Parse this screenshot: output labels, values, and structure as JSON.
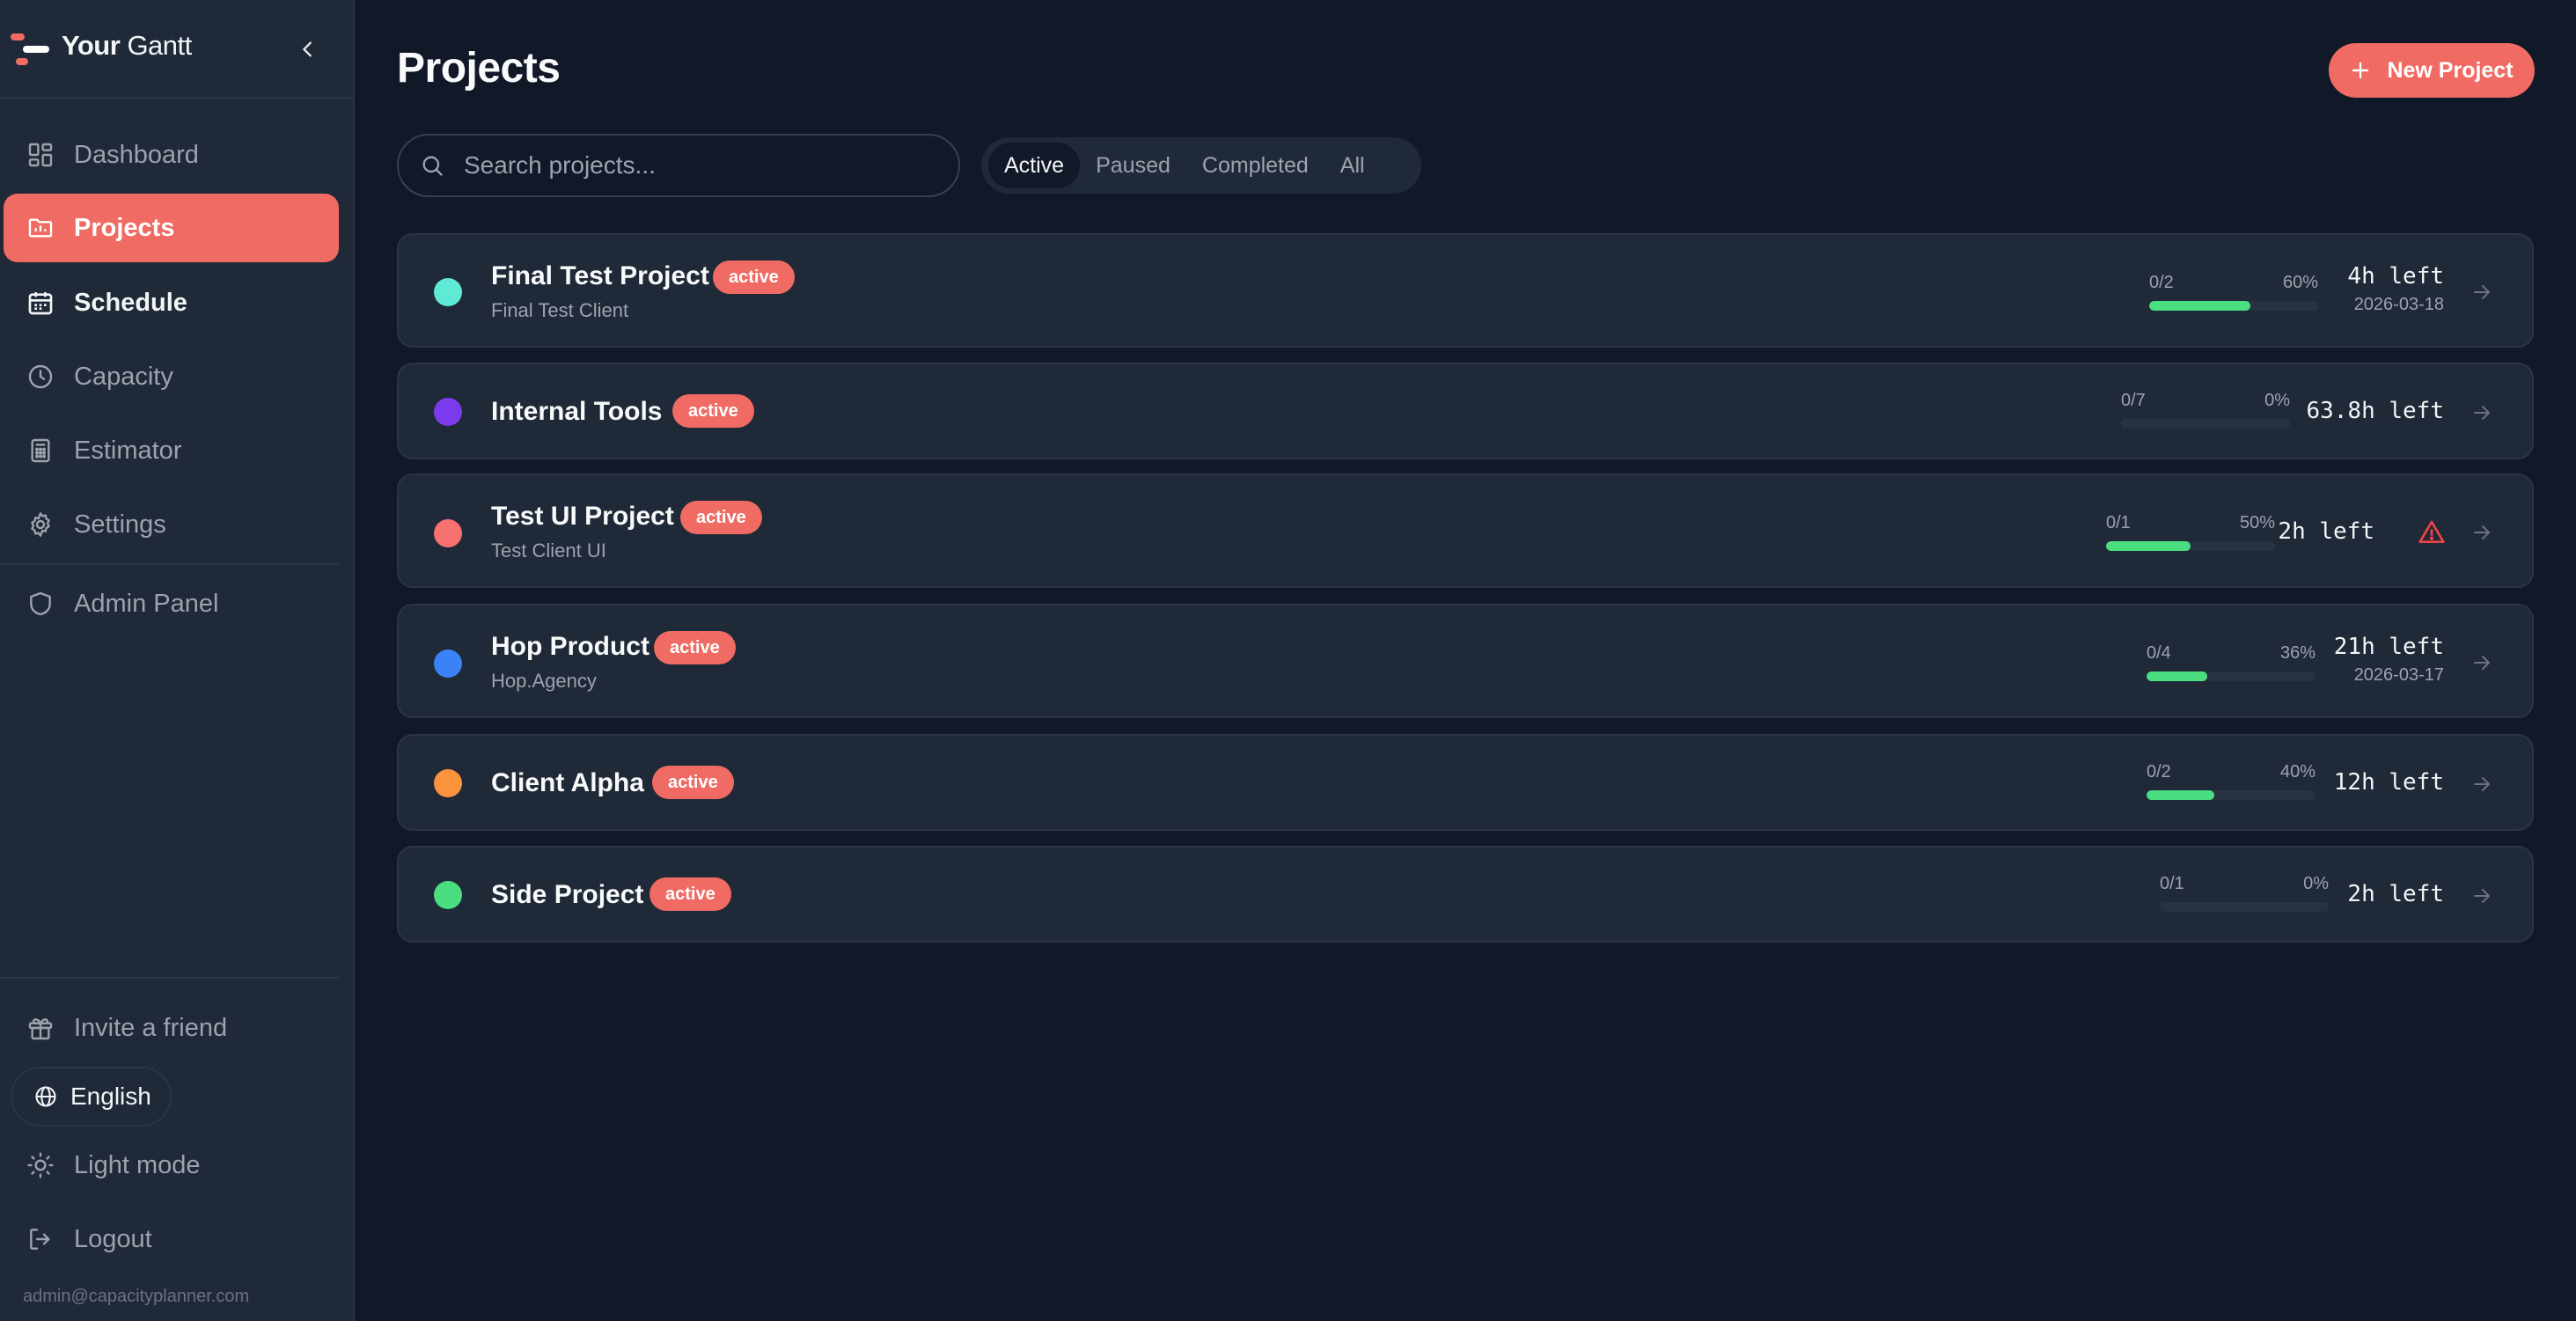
{
  "app": {
    "brand_bold": "Your",
    "brand_light": "Gantt",
    "accent": "#ef6b63",
    "progress_color": "#4ade80"
  },
  "sidebar": {
    "items": [
      {
        "label": "Dashboard",
        "icon": "grid-icon"
      },
      {
        "label": "Projects",
        "icon": "folder-icon",
        "active": true
      },
      {
        "label": "Schedule",
        "icon": "calendar-icon"
      },
      {
        "label": "Capacity",
        "icon": "clock-icon"
      },
      {
        "label": "Estimator",
        "icon": "calculator-icon"
      },
      {
        "label": "Settings",
        "icon": "gear-icon"
      },
      {
        "label": "Admin Panel",
        "icon": "shield-icon"
      }
    ],
    "invite": "Invite a friend",
    "language": "English",
    "theme": "Light mode",
    "logout": "Logout",
    "user_email": "admin@capacityplanner.com"
  },
  "main": {
    "title": "Projects",
    "new_project_label": "New Project",
    "search_placeholder": "Search projects...",
    "filters": [
      {
        "label": "Active",
        "active": true
      },
      {
        "label": "Paused"
      },
      {
        "label": "Completed"
      },
      {
        "label": "All"
      }
    ],
    "projects": [
      {
        "name": "Final Test Project",
        "status": "active",
        "client": "Final Test Client",
        "color": "#5eead4",
        "tasks": "0/2",
        "percent_label": "60%",
        "percent": 60,
        "time_left": "4h left",
        "due": "2026-03-18"
      },
      {
        "name": "Internal Tools",
        "status": "active",
        "client": "",
        "color": "#7c3aed",
        "tasks": "0/7",
        "percent_label": "0%",
        "percent": 0,
        "time_left": "63.8h left",
        "due": ""
      },
      {
        "name": "Test UI Project",
        "status": "active",
        "client": "Test Client UI",
        "color": "#f87171",
        "tasks": "0/1",
        "percent_label": "50%",
        "percent": 50,
        "time_left": "2h left",
        "due": "",
        "warning": true
      },
      {
        "name": "Hop Product",
        "status": "active",
        "client": "Hop.Agency",
        "color": "#3b82f6",
        "tasks": "0/4",
        "percent_label": "36%",
        "percent": 36,
        "time_left": "21h left",
        "due": "2026-03-17"
      },
      {
        "name": "Client Alpha",
        "status": "active",
        "client": "",
        "color": "#fb923c",
        "tasks": "0/2",
        "percent_label": "40%",
        "percent": 40,
        "time_left": "12h left",
        "due": ""
      },
      {
        "name": "Side Project",
        "status": "active",
        "client": "",
        "color": "#4ade80",
        "tasks": "0/1",
        "percent_label": "0%",
        "percent": 0,
        "time_left": "2h left",
        "due": ""
      }
    ]
  }
}
